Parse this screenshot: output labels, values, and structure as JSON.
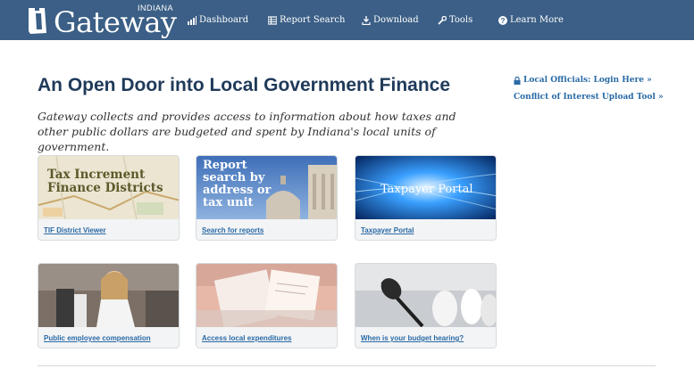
{
  "header": {
    "logo_word": "Gateway",
    "logo_state": "INDIANA",
    "nav": [
      {
        "label": "Dashboard",
        "icon": "bar-chart-icon"
      },
      {
        "label": "Report Search",
        "icon": "table-icon"
      },
      {
        "label": "Download",
        "icon": "download-icon"
      },
      {
        "label": "Tools",
        "icon": "wrench-icon"
      },
      {
        "label": "Learn More",
        "icon": "question-icon"
      }
    ]
  },
  "main": {
    "title": "An Open Door into Local Government Finance",
    "intro": "Gateway collects and provides access to information about how taxes and other public dollars are budgeted and spent by Indiana's local units of government."
  },
  "side_links": [
    {
      "label": "Local Officials: Login Here »",
      "icon": "lock-icon"
    },
    {
      "label": "Conflict of Interest Upload Tool »"
    }
  ],
  "cards": [
    {
      "label": "TIF District Viewer",
      "image_text": "Tax Increment Finance Districts"
    },
    {
      "label": "Search for reports",
      "image_text": "Report search by address or tax unit"
    },
    {
      "label": "Taxpayer Portal",
      "image_text": "Taxpayer Portal"
    },
    {
      "label": "Public employee compensation"
    },
    {
      "label": "Access local expenditures"
    },
    {
      "label": "When is your budget hearing?"
    }
  ],
  "colors": {
    "header_bg": "#3b5f86",
    "title": "#1f3a5a",
    "link": "#2a6aa6"
  }
}
